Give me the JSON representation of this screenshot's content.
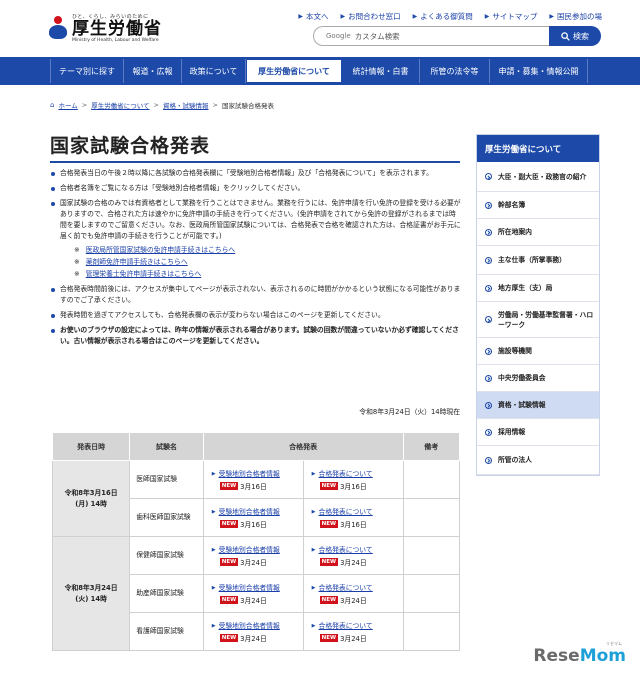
{
  "header": {
    "tagline": "ひと、くらし、みらいのために",
    "org_name": "厚生労働省",
    "org_name_en": "Ministry of Health, Labour and Welfare",
    "top_links": [
      "本文へ",
      "お問合わせ窓口",
      "よくある御質問",
      "サイトマップ",
      "国民参加の場"
    ],
    "search_prefix": "Google",
    "search_placeholder": "カスタム検索",
    "search_button": "検索"
  },
  "nav": {
    "items": [
      "テーマ別に探す",
      "報道・広報",
      "政策について",
      "厚生労働省について",
      "統計情報・白書",
      "所管の法令等",
      "申請・募集・情報公開"
    ],
    "active_index": 3
  },
  "breadcrumb": {
    "items": [
      "ホーム",
      "厚生労働省について",
      "資格・試験情報"
    ],
    "current": "国家試験合格発表"
  },
  "page": {
    "title": "国家試験合格発表",
    "bullets": [
      "合格発表当日の午後２時以降に各試験の合格発表欄に「受験地別合格者情報」及び「合格発表について」を表示されます。",
      "合格者名簿をご覧になる方は「受験地別合格者情報」をクリックしてください。",
      "国家試験の合格のみでは有資格者として業務を行うことはできません。業務を行うには、免許申請を行い免許の登録を受ける必要がありますので、合格された方は速やかに免許申請の手続きを行ってください。(免許申請をされてから免許の登録がされるまでは時間を要しますのでご留意ください。なお、医政局所管国家試験については、合格発表で合格を確認された方は、合格証書がお手元に届く前でも免許申請の手続きを行うことが可能です。)",
      "合格発表時間前後には、アクセスが集中してページが表示されない、表示されるのに時間がかかるという状態になる可能性がありますのでご了承ください。",
      "発表時間を過ぎてアクセスしても、合格発表欄の表示が変わらない場合はこのページを更新してください。",
      "お使いのブラウザの設定によっては、昨年の情報が表示される場合があります。試験の回数が間違っていないか必ず確認してください。古い情報が表示される場合はこのページを更新してください。"
    ],
    "sublinks_mark": "※",
    "sublinks": [
      "医政局所管国家試験の免許申請手続きはこちらへ",
      "薬剤師免許申請手続きはこちらへ",
      "管理栄養士免許申請手続きはこちらへ"
    ],
    "timestamp": "令和8年3月24日（火）14時現在"
  },
  "table": {
    "headers": [
      "発表日時",
      "試験名",
      "合格発表",
      "備考"
    ],
    "link_results": "受験地別合格者情報",
    "link_announce": "合格発表について",
    "new_label": "NEW",
    "groups": [
      {
        "date": [
          "令和8年3月16日",
          "(月) 14時"
        ],
        "rows": [
          {
            "exam": "医師国家試験",
            "d1": "3月16日",
            "d2": "3月16日"
          },
          {
            "exam": "歯科医師国家試験",
            "d1": "3月16日",
            "d2": "3月16日"
          }
        ]
      },
      {
        "date": [
          "令和8年3月24日",
          "(火) 14時"
        ],
        "rows": [
          {
            "exam": "保健師国家試験",
            "d1": "3月24日",
            "d2": "3月24日"
          },
          {
            "exam": "助産師国家試験",
            "d1": "3月24日",
            "d2": "3月24日"
          },
          {
            "exam": "看護師国家試験",
            "d1": "3月24日",
            "d2": "3月24日"
          }
        ]
      }
    ]
  },
  "sidebar": {
    "title": "厚生労働省について",
    "items": [
      "大臣・副大臣・政務官の紹介",
      "幹部名簿",
      "所在地案内",
      "主な仕事（所掌事務）",
      "地方厚生（支）局",
      "労働局・労働基準監督署・ハローワーク",
      "施設等機関",
      "中央労働委員会",
      "資格・試験情報",
      "採用情報",
      "所管の法人"
    ],
    "active_index": 8
  },
  "watermark": {
    "text_a": "Rese",
    "text_b": "Mom",
    "small": "リセマム"
  }
}
